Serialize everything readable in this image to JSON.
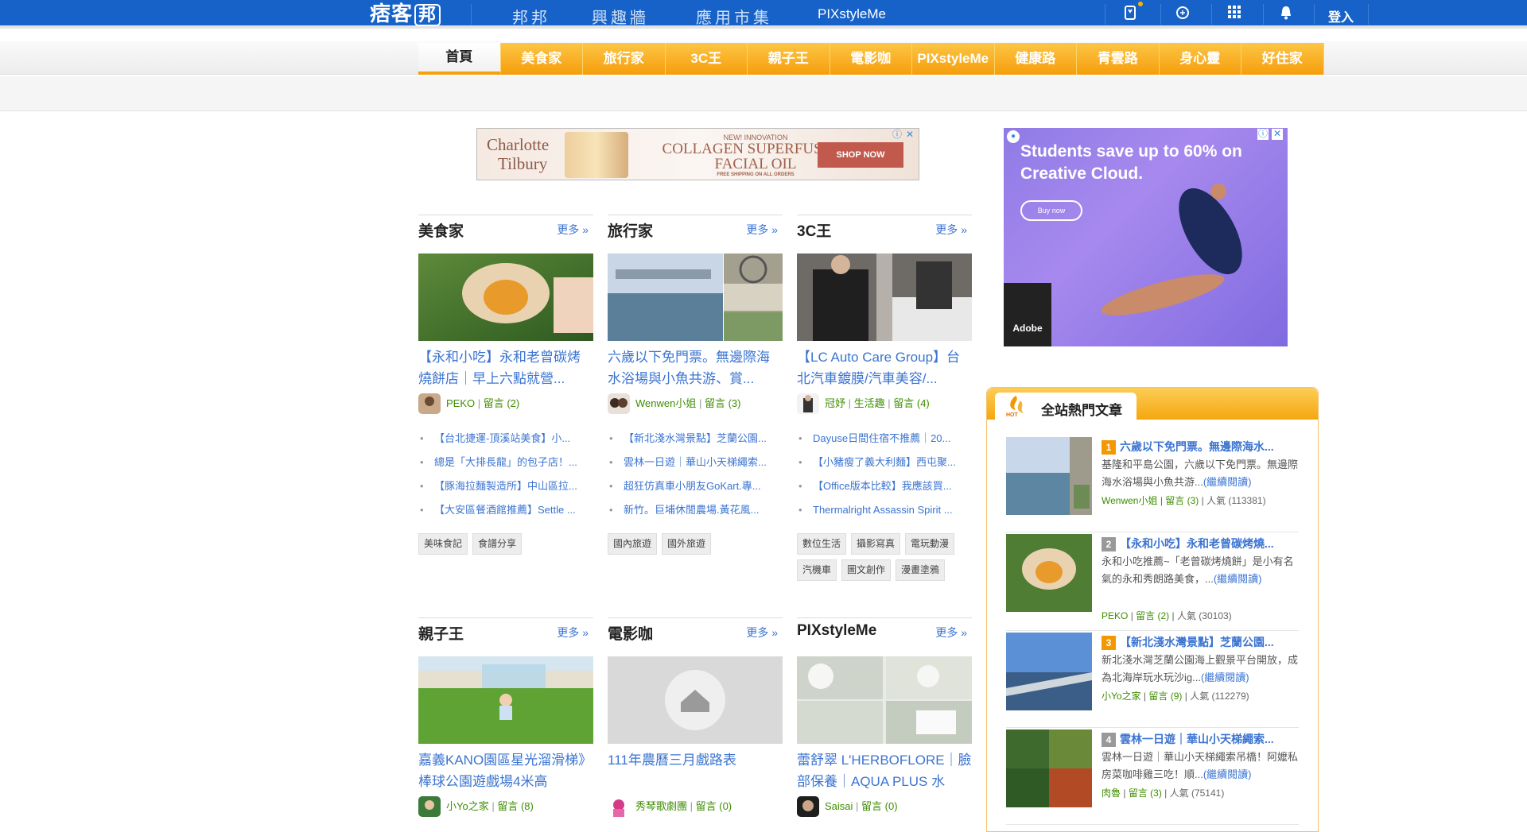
{
  "topbar": {
    "logo_text": "痞客",
    "logo_badge": "邦",
    "links": [
      "邦邦",
      "興趣牆",
      "應用市集",
      "PIXstyleMe"
    ],
    "login": "登入",
    "icons": [
      "bookmark-icon",
      "search-icon",
      "apps-grid-icon",
      "bell-icon"
    ]
  },
  "nav": [
    "首頁",
    "美食家",
    "旅行家",
    "3C王",
    "親子王",
    "電影咖",
    "PIXstyleMe",
    "健康路",
    "青雲路",
    "身心靈",
    "好住家"
  ],
  "ad_banner": {
    "brand_line1": "Charlotte",
    "brand_line2": "Tilbury",
    "head1": "NEW! INNOVATION",
    "head2a": "COLLAGEN SUPERFUSION",
    "head2b": "FACIAL OIL",
    "head3": "FREE SHIPPING ON ALL ORDERS",
    "button": "SHOP NOW"
  },
  "ad_side": {
    "text": "Students save up to 60% on Creative Cloud.",
    "button": "Buy now",
    "brand": "Adobe"
  },
  "more_label": "更多 »",
  "sections": [
    {
      "title": "美食家",
      "headline": "【永和小吃】永和老曾碳烤燒餅店｜早上六點就營...",
      "author": "PEKO",
      "comments": "留言 (2)",
      "bullets": [
        "【台北捷運-頂溪站美食】小...",
        "總是「大排長龍」的包子店！...",
        "【豚海拉麵製造所】中山區拉...",
        "【大安區餐酒館推薦】Settle ..."
      ],
      "tags": [
        "美味食記",
        "食譜分享"
      ]
    },
    {
      "title": "旅行家",
      "headline": "六歲以下免門票。無邊際海水浴場與小魚共游、賞...",
      "author": "Wenwen小姐",
      "comments": "留言 (3)",
      "bullets": [
        "【新北淺水灣景點】芝蘭公園...",
        "雲林一日遊｜華山小天梯繩索...",
        "超狂仿真車小朋友GoKart.專...",
        "新竹。巨埔休閒農場.黃花風..."
      ],
      "tags": [
        "國內旅遊",
        "國外旅遊"
      ]
    },
    {
      "title": "3C王",
      "headline": "【LC Auto Care Group】台北汽車鍍膜/汽車美容/...",
      "author": "冠妤",
      "category": "生活趣",
      "comments": "留言 (4)",
      "bullets": [
        "Dayuse日間住宿不推薦｜20...",
        "【小豬瘦了義大利麵】西屯聚...",
        "【Office版本比較】我應該買...",
        "Thermalright Assassin Spirit ..."
      ],
      "tags": [
        "數位生活",
        "攝影寫真",
        "電玩動漫",
        "汽機車",
        "圖文創作",
        "漫畫塗鴉"
      ]
    },
    {
      "title": "親子王",
      "headline": "嘉義KANO園區星光溜滑梯》棒球公園遊戲場4米高",
      "author": "小Yo之家",
      "comments": "留言 (8)"
    },
    {
      "title": "電影咖",
      "headline": "111年農曆三月戲路表",
      "author": "秀琴歌劇團",
      "comments": "留言 (0)"
    },
    {
      "title": "PIXstyleMe",
      "headline": "蕾舒翠 L'HERBOFLORE｜臉部保養｜AQUA PLUS 水",
      "author": "Saisai",
      "comments": "留言 (0)"
    }
  ],
  "hot": {
    "badge": "HOT",
    "title": "全站熱門文章",
    "more_text": "(繼續閱讀)",
    "items": [
      {
        "rank": "1",
        "title": "六歲以下免門票。無邊際海水...",
        "desc": "基隆和平島公園，六歲以下免門票。無邊際海水浴場與小魚共游...",
        "author": "Wenwen小姐",
        "comments": "留言 (3)",
        "popularity": "人氣 (113381)"
      },
      {
        "rank": "2",
        "title": "【永和小吃】永和老曾碳烤燒...",
        "desc": "永和小吃推薦~「老曾碳烤燒餅」是小有名氣的永和秀朗路美食，...",
        "author": "PEKO",
        "comments": "留言 (2)",
        "popularity": "人氣 (30103)"
      },
      {
        "rank": "3",
        "title": "【新北淺水灣景點】芝蘭公園...",
        "desc": "新北淺水灣芝蘭公園海上觀景平台開放，成為北海岸玩水玩沙ig...",
        "author": "小Yo之家",
        "comments": "留言 (9)",
        "popularity": "人氣 (112279)"
      },
      {
        "rank": "4",
        "title": "雲林一日遊｜華山小天梯繩索...",
        "desc": "雲林一日遊｜華山小天梯繩索吊橋！阿嬤私房菜咖啡雞三吃！順...",
        "author": "肉魯",
        "comments": "留言 (3)",
        "popularity": "人氣 (75141)"
      }
    ]
  },
  "colors": {
    "topbar": "#1662c8",
    "nav_orange": "#f59e0c",
    "link_blue": "#3b74d1",
    "author_green": "#3e8e00",
    "rank_orange": "#f39800",
    "rank_gray": "#999999"
  }
}
